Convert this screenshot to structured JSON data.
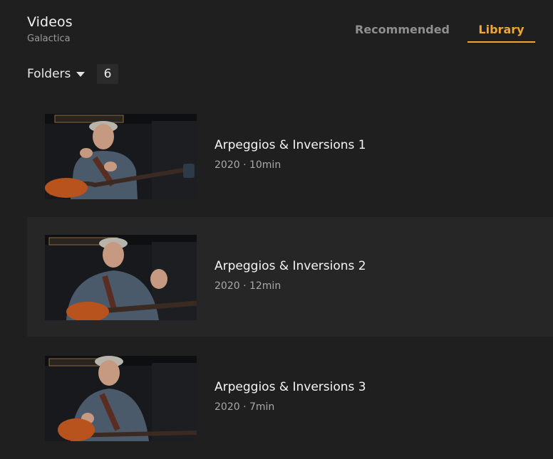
{
  "header": {
    "title": "Videos",
    "subtitle": "Galactica"
  },
  "tabs": [
    {
      "label": "Recommended",
      "active": false
    },
    {
      "label": "Library",
      "active": true
    }
  ],
  "accent_color": "#f2a531",
  "folders": {
    "label": "Folders",
    "count": "6"
  },
  "videos": [
    {
      "title": "Arpeggios & Inversions 1",
      "meta": "2020 · 10min"
    },
    {
      "title": "Arpeggios & Inversions 2",
      "meta": "2020 · 12min"
    },
    {
      "title": "Arpeggios & Inversions 3",
      "meta": "2020 · 7min"
    }
  ]
}
